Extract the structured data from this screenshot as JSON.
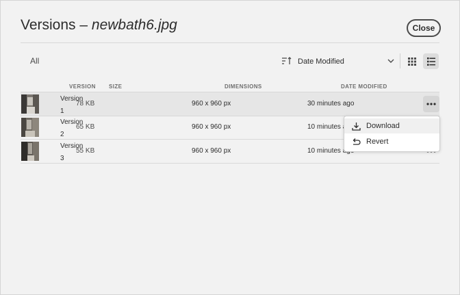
{
  "dialog": {
    "title_prefix": "Versions – ",
    "title_filename": "newbath6.jpg",
    "close_label": "Close"
  },
  "toolbar": {
    "filter_label": "All",
    "sort_label": "Date Modified",
    "sort_icon": "sort-descending-icon",
    "view_modes": [
      "grid-view-icon",
      "list-view-icon"
    ],
    "active_view": "list"
  },
  "columns": {
    "version": "VERSION",
    "size": "SIZE",
    "dimensions": "DIMENSIONS",
    "date_modified": "DATE MODIFIED"
  },
  "rows": [
    {
      "version_label": "Version",
      "version_number": "1",
      "size": "78 KB",
      "dimensions": "960 x 960 px",
      "date": "30 minutes ago",
      "selected": true
    },
    {
      "version_label": "Version",
      "version_number": "2",
      "size": "65 KB",
      "dimensions": "960 x 960 px",
      "date": "10 minutes ago",
      "selected": false
    },
    {
      "version_label": "Version",
      "version_number": "3",
      "size": "55 KB",
      "dimensions": "960 x 960 px",
      "date": "10 minutes ago",
      "selected": false
    }
  ],
  "context_menu": {
    "items": [
      {
        "label": "Download",
        "icon": "download-icon"
      },
      {
        "label": "Revert",
        "icon": "revert-icon"
      }
    ]
  },
  "colors": {
    "background": "#f2f2f2",
    "text": "#2c2c2c",
    "muted": "#6e6e6e",
    "selected_row": "#e6e6e6",
    "divider": "#d8d8d8"
  }
}
